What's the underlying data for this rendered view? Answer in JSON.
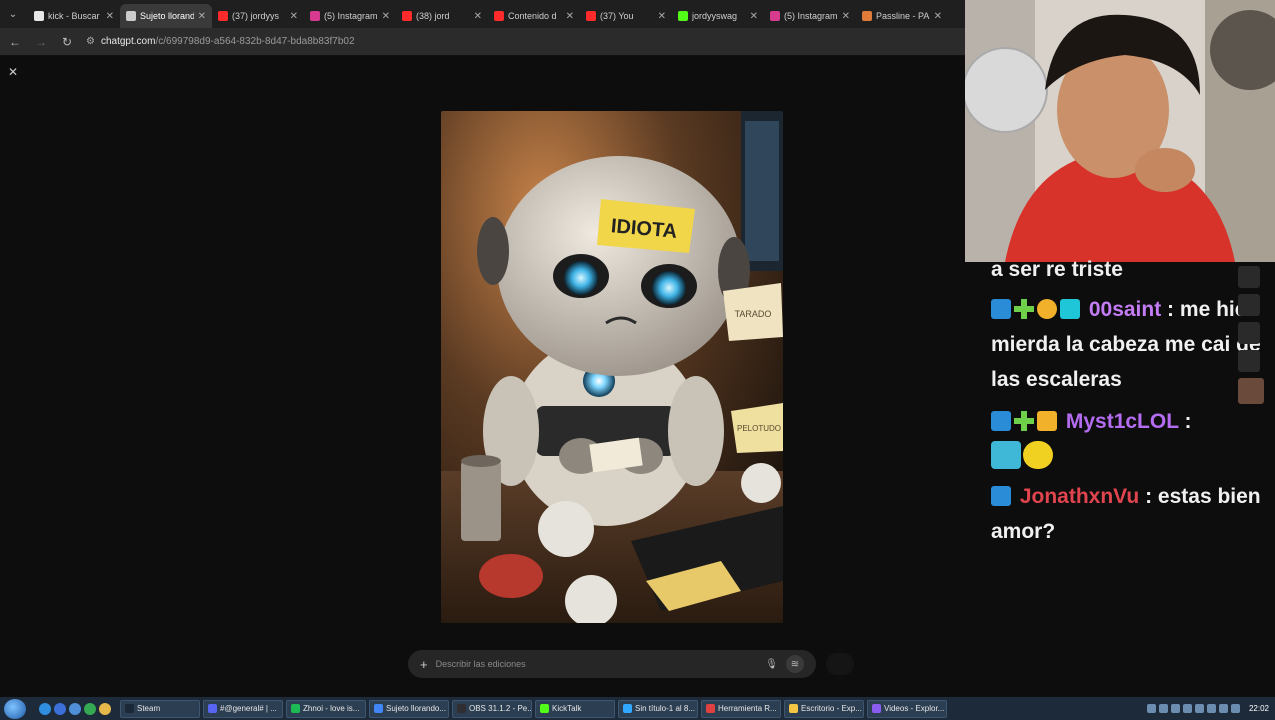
{
  "browser": {
    "tabs": [
      {
        "label": "kick - Buscar",
        "color": "#e8e8e8",
        "active": false
      },
      {
        "label": "Sujeto llorando",
        "color": "#cccccc",
        "active": true
      },
      {
        "label": "(37) jordyys",
        "color": "#ff2a2a",
        "active": false
      },
      {
        "label": "(5) Instagram",
        "color": "#d63b8f",
        "active": false
      },
      {
        "label": "(38) jord",
        "color": "#ff2a2a",
        "active": false
      },
      {
        "label": "Contenido d",
        "color": "#ff2a2a",
        "active": false
      },
      {
        "label": "(37) You",
        "color": "#ff2a2a",
        "active": false
      },
      {
        "label": "jordyyswag",
        "color": "#53fc18",
        "active": false
      },
      {
        "label": "(5) Instagram",
        "color": "#d63b8f",
        "active": false
      },
      {
        "label": "Passline - PA",
        "color": "#e07b39",
        "active": false
      }
    ],
    "url_host": "chatgpt.com",
    "url_path": "/c/699798d9-a564-832b-8d47-bda8b83f7b02"
  },
  "image": {
    "note_label": "IDIOTA",
    "paper_label_1": "TARADO",
    "paper_label_2": "PELOTUDO"
  },
  "prompt": {
    "placeholder": "Describir las ediciones"
  },
  "chat": {
    "fragment": "a ser re triste",
    "messages": [
      {
        "user": "00saint",
        "text": "me hice mierda la cabeza me cai de las escaleras",
        "user_color": "#c47cf5"
      },
      {
        "user": "Myst1cLOL",
        "text": "",
        "user_color": "#b46cf0"
      },
      {
        "user": "JonathxnVu",
        "text": "estas bien amor?",
        "user_color": "#e0444e"
      }
    ]
  },
  "taskbar": {
    "items": [
      {
        "label": "Steam",
        "color": "#1b2838"
      },
      {
        "label": "#@general# | ...",
        "color": "#5865f2"
      },
      {
        "label": "Zhnoi - love is...",
        "color": "#1db954"
      },
      {
        "label": "Sujeto llorando...",
        "color": "#4285f4"
      },
      {
        "label": "OBS 31.1.2 - Pe...",
        "color": "#302e31"
      },
      {
        "label": "KickTalk",
        "color": "#53fc18"
      },
      {
        "label": "Sin título-1 al 8...",
        "color": "#31a8ff"
      },
      {
        "label": "Herramienta R...",
        "color": "#e04040"
      },
      {
        "label": "Escritorio - Exp...",
        "color": "#f4c542"
      },
      {
        "label": "Videos - Explor...",
        "color": "#8a5cf0"
      }
    ],
    "clock": "22:02"
  }
}
